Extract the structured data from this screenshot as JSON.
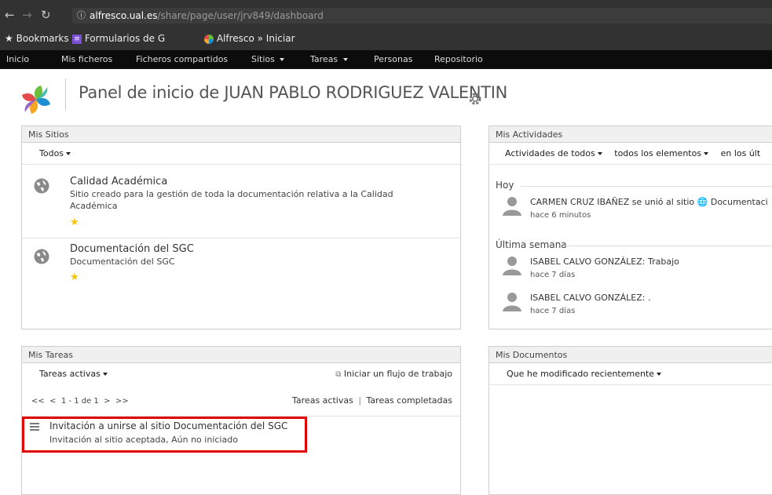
{
  "browser": {
    "url_host": "alfresco.ual.es",
    "url_path": "/share/page/user/jrv849/dashboard",
    "bookmarks": [
      {
        "label": "Bookmarks",
        "icon": "star-icon"
      },
      {
        "label": "Formularios de G",
        "icon": "forms-icon"
      },
      {
        "label": "Alfresco » Iniciar",
        "icon": "alfresco-icon"
      }
    ]
  },
  "nav": {
    "items": [
      "Inicio",
      "Mis ficheros",
      "Ficheros compartidos",
      "Sitios",
      "Tareas",
      "Personas",
      "Repositorio"
    ]
  },
  "header": {
    "title": "Panel de inicio de JUAN PABLO RODRIGUEZ VALENTIN"
  },
  "mis_sitios": {
    "title": "Mis Sitios",
    "filter": "Todos",
    "sites": [
      {
        "name": "Calidad Académica",
        "description": "Sitio creado para la gestión de toda la documentación relativa a la Calidad Académica"
      },
      {
        "name": "Documentación del SGC",
        "description": "Documentación del SGC"
      }
    ]
  },
  "mis_actividades": {
    "title": "Mis Actividades",
    "filter_who": "Actividades de todos",
    "filter_what": "todos los elementos",
    "filter_when": "en los últ",
    "sections": [
      {
        "label": "Hoy",
        "items": [
          {
            "text": "CARMEN CRUZ IBAÑEZ se unió al sitio ",
            "link": "Documentaci",
            "time": "hace 6 minutos"
          }
        ]
      },
      {
        "label": "Última semana",
        "items": [
          {
            "text": "ISABEL CALVO GONZÁLEZ: Trabajo",
            "time": "hace 7 días"
          },
          {
            "text": "ISABEL CALVO GONZÁLEZ: .",
            "time": "hace 7 días"
          }
        ]
      }
    ]
  },
  "mis_tareas": {
    "title": "Mis Tareas",
    "filter": "Tareas activas",
    "start_workflow": "Iniciar un flujo de trabajo",
    "pager_first": "<<",
    "pager_prev": "<",
    "pager_info": "1 - 1 de 1",
    "pager_next": ">",
    "pager_last": ">>",
    "tab_active": "Tareas activas",
    "separator": "|",
    "tab_completed": "Tareas completadas",
    "task": {
      "title": "Invitación a unirse al sitio Documentación del SGC",
      "status": "Invitación al sitio aceptada, Aún no iniciado"
    }
  },
  "mis_documentos": {
    "title": "Mis Documentos",
    "filter": "Que he modificado recientemente"
  },
  "colors": {
    "accent": "#e00000",
    "nav_bg": "#0c0c0c",
    "star": "#f5c20a"
  }
}
